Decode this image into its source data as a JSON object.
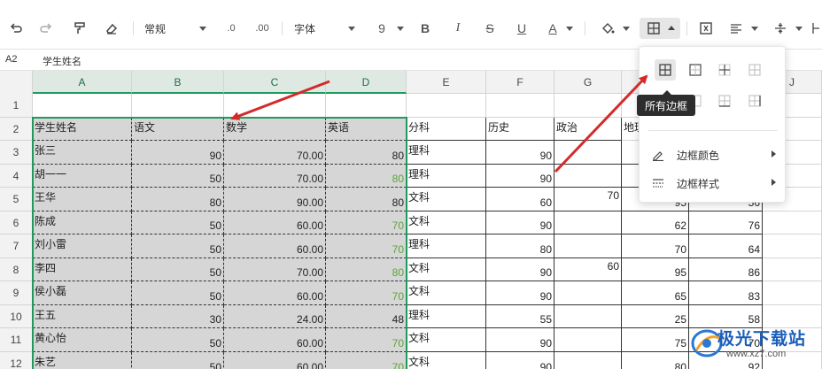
{
  "toolbar": {
    "number_format": "常规",
    "decimal_decrease": ".0",
    "decimal_increase": ".00",
    "font_name": "字体",
    "font_size": "9",
    "bold": "B",
    "italic": "I",
    "strike": "S",
    "underline": "U",
    "font_color": "A"
  },
  "formula_bar": {
    "cell_ref": "A2",
    "content": "学生姓名"
  },
  "columns": [
    "A",
    "B",
    "C",
    "D",
    "E",
    "F",
    "G",
    "H",
    "I",
    "J"
  ],
  "rows": [
    "1",
    "2",
    "3",
    "4",
    "5",
    "6",
    "7",
    "8",
    "9",
    "10",
    "11",
    "12"
  ],
  "header_row": [
    "学生姓名",
    "语文",
    "数学",
    "英语",
    "分科",
    "历史",
    "政治",
    "地理"
  ],
  "data_rows": [
    {
      "name": "张三",
      "b": "90",
      "c": "70.00",
      "d": "80",
      "e": "理科",
      "f": "90",
      "g": "",
      "h": "",
      "i": "",
      "d_green": false
    },
    {
      "name": "胡一一",
      "b": "50",
      "c": "70.00",
      "d": "80",
      "e": "理科",
      "f": "90",
      "g": "",
      "h": "",
      "i": "",
      "d_green": true
    },
    {
      "name": "王华",
      "b": "80",
      "c": "90.00",
      "d": "80",
      "e": "文科",
      "f": "60",
      "g": "70",
      "h": "95",
      "i": "56",
      "d_green": false
    },
    {
      "name": "陈成",
      "b": "50",
      "c": "60.00",
      "d": "70",
      "e": "文科",
      "f": "90",
      "g": "",
      "h": "62",
      "i": "76",
      "d_green": true
    },
    {
      "name": "刘小雷",
      "b": "50",
      "c": "60.00",
      "d": "70",
      "e": "理科",
      "f": "80",
      "g": "",
      "h": "70",
      "i": "64",
      "d_green": true
    },
    {
      "name": "李四",
      "b": "50",
      "c": "70.00",
      "d": "80",
      "e": "文科",
      "f": "90",
      "g": "60",
      "h": "95",
      "i": "86",
      "d_green": true
    },
    {
      "name": "侯小磊",
      "b": "50",
      "c": "60.00",
      "d": "70",
      "e": "文科",
      "f": "90",
      "g": "",
      "h": "65",
      "i": "83",
      "d_green": true
    },
    {
      "name": "王五",
      "b": "30",
      "c": "24.00",
      "d": "48",
      "e": "理科",
      "f": "55",
      "g": "",
      "h": "25",
      "i": "58",
      "d_green": false
    },
    {
      "name": "黄心怡",
      "b": "50",
      "c": "60.00",
      "d": "70",
      "e": "文科",
      "f": "90",
      "g": "",
      "h": "75",
      "i": "70",
      "d_green": true
    },
    {
      "name": "朱艺",
      "b": "50",
      "c": "60.00",
      "d": "70",
      "e": "文科",
      "f": "90",
      "g": "",
      "h": "80",
      "i": "92",
      "d_green": true
    }
  ],
  "dropdown": {
    "tooltip": "所有边框",
    "border_color_label": "边框颜色",
    "border_style_label": "边框样式"
  },
  "watermark": {
    "title": "极光下载站",
    "url": "www.xz7.com"
  },
  "colors": {
    "accent": "#1f9a5c",
    "selection": "#d6d6d6",
    "arrow": "#d42a2a",
    "green_text": "#5aa53a"
  }
}
